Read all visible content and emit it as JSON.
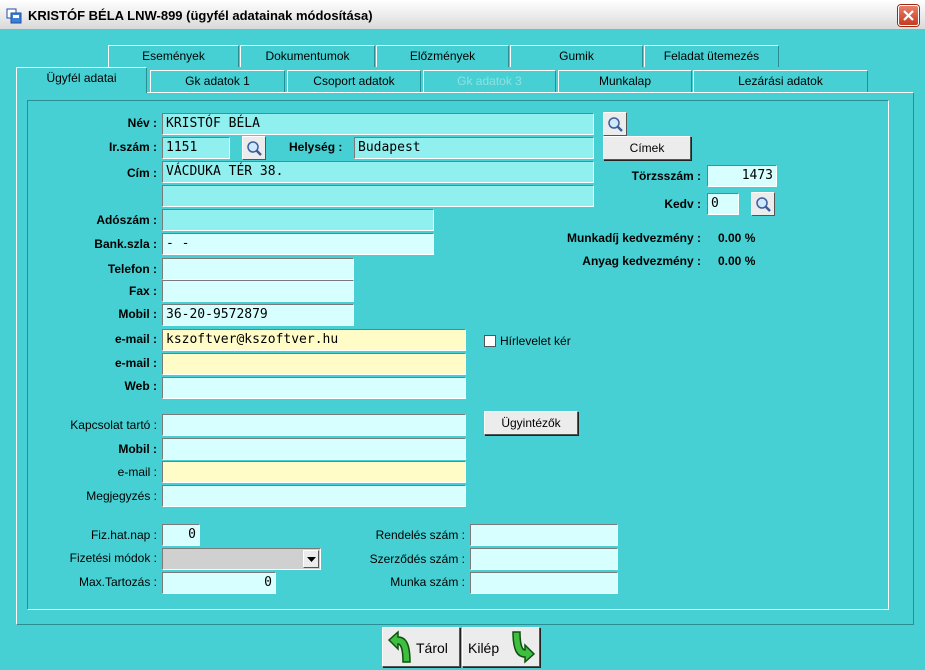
{
  "window": {
    "title": "KRISTÓF BÉLA   LNW-899 (ügyfél adatainak módosítása)"
  },
  "tabs_row1": [
    "Események",
    "Dokumentumok",
    "Előzmények",
    "Gumik",
    "Feladat ütemezés"
  ],
  "tabs_row2": [
    "Ügyfél adatai",
    "Gk adatok 1",
    "Csoport adatok",
    "Gk adatok 3",
    "Munkalap",
    "Lezárási adatok"
  ],
  "labels": {
    "nev": "Név :",
    "irszam": "Ir.szám :",
    "helyseg": "Helység :",
    "cim": "Cím :",
    "adoszam": "Adószám :",
    "bankszla": "Bank.szla :",
    "telefon": "Telefon :",
    "fax": "Fax :",
    "mobil": "Mobil :",
    "email": "e-mail :",
    "email2": "e-mail :",
    "web": "Web :",
    "kapcsolat": "Kapcsolat tartó :",
    "kmobil": "Mobil :",
    "kemail": "e-mail :",
    "megjegyzes": "Megjegyzés :",
    "fizhatnap": "Fiz.hat.nap :",
    "fizmod": "Fizetési módok :",
    "maxtart": "Max.Tartozás :",
    "rendeles": "Rendelés szám :",
    "szerzodes": "Szerződés szám :",
    "munka": "Munka szám :",
    "torzsszam": "Törzsszám :",
    "kedv": "Kedv :",
    "munkadij": "Munkadíj kedvezmény :",
    "anyag": "Anyag kedvezmény :",
    "hirlevel": "Hírlevelet kér"
  },
  "values": {
    "nev": "KRISTÓF BÉLA",
    "irszam": "1151",
    "helyseg": "Budapest",
    "cim1": "VÁCDUKA TÉR 38.",
    "cim2": "",
    "adoszam": "",
    "bankszla": "        -         -",
    "telefon": "",
    "fax": "",
    "mobil": "36-20-9572879",
    "email": "kszoftver@kszoftver.hu",
    "email2": "",
    "web": "",
    "kapcsolat": "",
    "kmobil": "",
    "kemail": "",
    "megjegyzes": "",
    "fizhatnap": "0",
    "fizmod": "",
    "maxtart": "0",
    "rendeles": "",
    "szerzodes": "",
    "munka": "",
    "torzsszam": "1473",
    "kedv": "0",
    "munkadij": "0.00 %",
    "anyag": "0.00 %"
  },
  "buttons": {
    "cimek": "Címek",
    "ugyintezok": "Ügyintézők",
    "tarol": "Tárol",
    "kilep": "Kilép"
  },
  "colors": {
    "background": "#46d0d3",
    "field": "#8ff0ef",
    "field_light": "#d7ffff",
    "field_yellow": "#fffcc8"
  }
}
